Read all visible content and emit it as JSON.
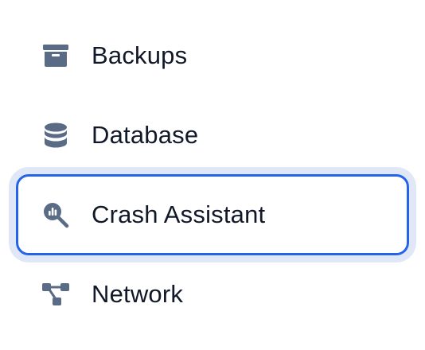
{
  "nav": {
    "items": [
      {
        "label": "Backups",
        "icon": "archive-box-icon",
        "active": false
      },
      {
        "label": "Database",
        "icon": "database-icon",
        "active": false
      },
      {
        "label": "Crash Assistant",
        "icon": "chart-magnifier-icon",
        "active": true
      },
      {
        "label": "Network",
        "icon": "network-nodes-icon",
        "active": false
      }
    ]
  },
  "colors": {
    "icon": "#5a6b86",
    "text": "#111827",
    "active_border": "#2563eb",
    "active_ring": "#e0e8f8",
    "background": "#ffffff"
  }
}
